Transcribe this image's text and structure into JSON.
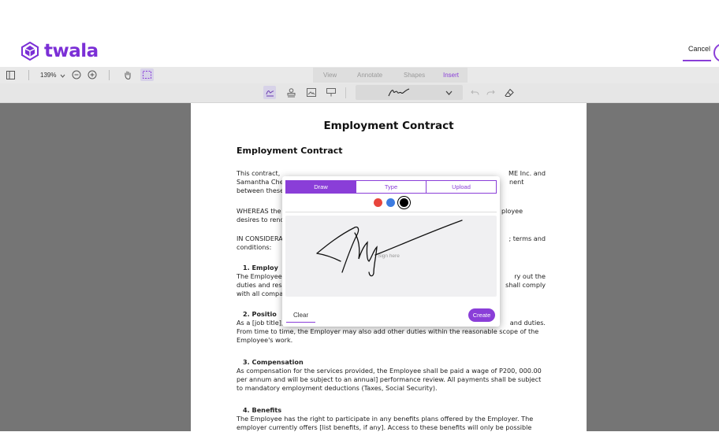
{
  "brand": {
    "name": "twala",
    "color": "#7b2fd6"
  },
  "header": {
    "cancel_label": "Cancel"
  },
  "toolbar": {
    "zoom": "139%",
    "tabs": [
      {
        "label": "View",
        "active": false
      },
      {
        "label": "Annotate",
        "active": false
      },
      {
        "label": "Shapes",
        "active": false
      },
      {
        "label": "Insert",
        "active": true
      }
    ]
  },
  "document": {
    "page_title": "Employment Contract",
    "heading": "Employment Contract",
    "intro_1": "This contract,",
    "intro_1_end": "ME Inc. and",
    "intro_2": "Samantha Che",
    "intro_2_end": "nent",
    "intro_3": "between these",
    "whereas_1": "WHEREAS the",
    "whereas_1_end": "ployee",
    "whereas_2": "desires to rend",
    "consideration_1": "IN CONSIDERA",
    "consideration_1_end": "; terms and",
    "consideration_2": "conditions:",
    "s1_title": "1.  Employ",
    "s1_1": "The Employee",
    "s1_1_end": "ry out the",
    "s1_2": "duties and res",
    "s1_2_end": "shall comply",
    "s1_3": "with all compa",
    "s2_title": "2.  Positio",
    "s2_1": "As a [job title],",
    "s2_1_end": "and duties.",
    "s2_2": "From time to time, the Employer may also add other duties within the reasonable scope of the",
    "s2_3": "Employee's work.",
    "s3_title": "3.  Compensation",
    "s3_1": "As compensation for the services provided, the Employee shall be paid a wage of P200, 000.00",
    "s3_2": "per annum and will be subject to an annual] performance review. All payments shall be subject",
    "s3_3": "to mandatory employment deductions (Taxes, Social Security).",
    "s4_title": "4.  Benefits",
    "s4_1": "The Employee has the right to participate in any benefits plans offered by the Employer. The",
    "s4_2": "employer currently offers [list benefits, if any]. Access to these benefits will only be possible"
  },
  "signature_modal": {
    "tabs": [
      {
        "label": "Draw",
        "active": true
      },
      {
        "label": "Type",
        "active": false
      },
      {
        "label": "Upload",
        "active": false
      }
    ],
    "colors": [
      "#e8453c",
      "#3d7be0",
      "#000000"
    ],
    "selected_color": "#000000",
    "placeholder": "Sign here",
    "clear_label": "Clear",
    "create_label": "Create"
  },
  "accent": "#8a3ed8"
}
